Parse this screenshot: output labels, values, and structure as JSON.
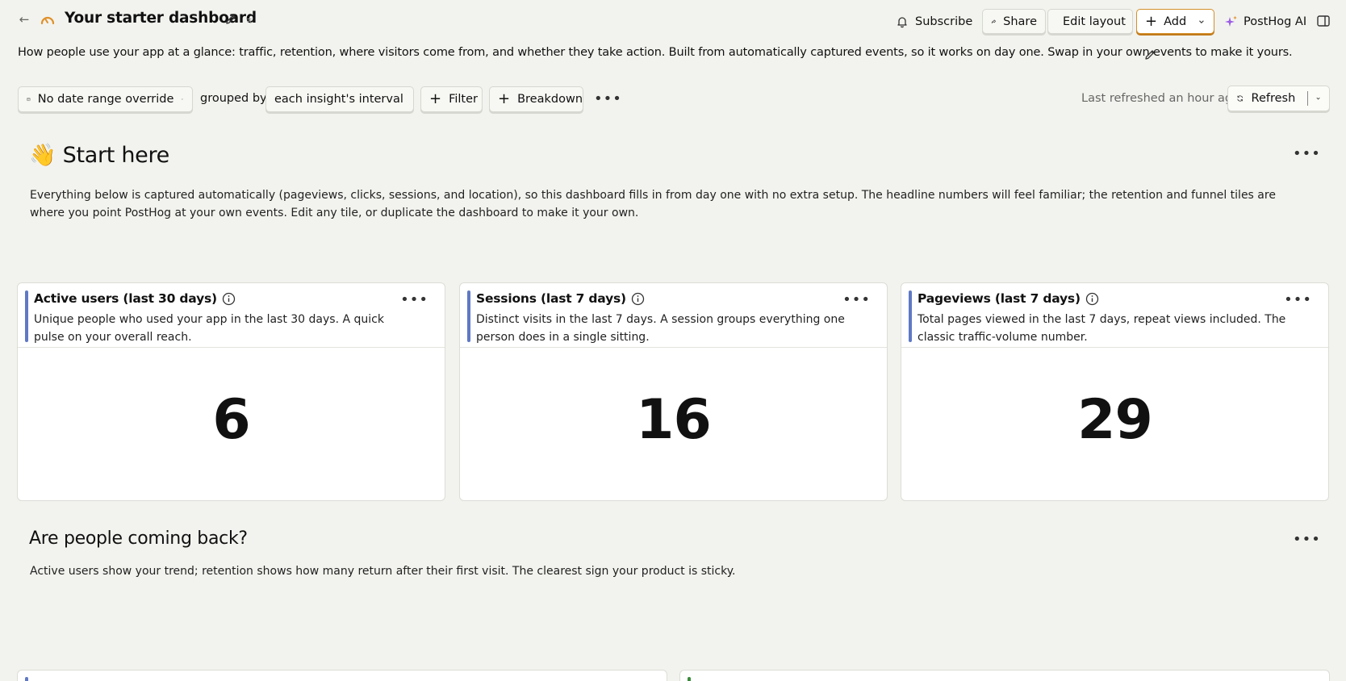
{
  "header": {
    "title": "Your starter dashboard",
    "subscribe_label": "Subscribe",
    "share_label": "Share",
    "edit_layout_label": "Edit layout",
    "add_label": "Add",
    "ai_label": "PostHog AI",
    "accent_color": "#d48f2a"
  },
  "description": "How people use your app at a glance: traffic, retention, where visitors come from, and whether they take action. Built from automatically captured events, so it works on day one. Swap in your own events to make it yours.",
  "filters": {
    "date_range": "No date range override",
    "grouped_by_label": "grouped by",
    "interval": "each insight's interval",
    "filter_label": "Filter",
    "breakdown_label": "Breakdown",
    "last_refreshed": "Last refreshed an hour ago",
    "refresh_label": "Refresh"
  },
  "sections": [
    {
      "title": "👋 Start here",
      "body": "Everything below is captured automatically (pageviews, clicks, sessions, and location), so this dashboard fills in from day one with no extra setup. The headline numbers will feel familiar; the retention and funnel tiles are where you point PostHog at your own events. Edit any tile, or duplicate the dashboard to make it your own."
    },
    {
      "title": "Are people coming back?",
      "body": "Active users show your trend; retention shows how many return after their first visit. The clearest sign your product is sticky."
    }
  ],
  "cards": [
    {
      "title": "Active users (last 30 days)",
      "description": "Unique people who used your app in the last 30 days. A quick pulse on your overall reach.",
      "value": "6"
    },
    {
      "title": "Sessions (last 7 days)",
      "description": "Distinct visits in the last 7 days. A session groups everything one person does in a single sitting.",
      "value": "16"
    },
    {
      "title": "Pageviews (last 7 days)",
      "description": "Total pages viewed in the last 7 days, repeat views included. The classic traffic-volume number.",
      "value": "29"
    }
  ],
  "card_accent_color": "#5f79c4",
  "icons": [
    "back-arrow-icon",
    "dashboard-icon",
    "pencil-icon",
    "pin-icon",
    "bell-icon",
    "share-icon",
    "grid-icon",
    "plus-icon",
    "chevron-down-icon",
    "sparkle-icon",
    "side-panel-icon",
    "calendar-icon",
    "refresh-icon",
    "info-icon",
    "more-icon"
  ]
}
